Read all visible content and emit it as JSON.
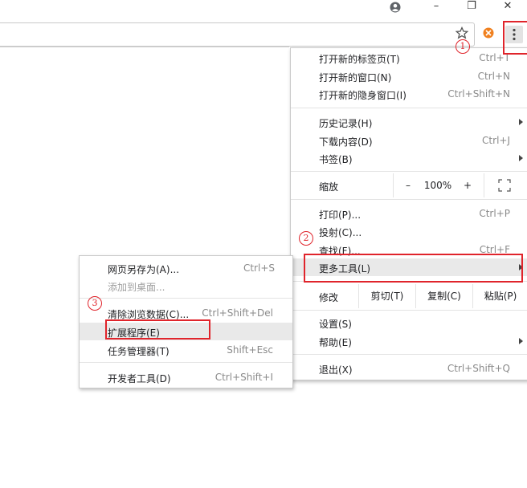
{
  "window": {
    "account_icon": "account-circle-icon",
    "minimize": "–",
    "restore": "❐",
    "close": "✕"
  },
  "toolbar": {
    "bookmark_icon": "star-icon",
    "extension_icon": "extension-orange-icon",
    "menu_icon": "three-dot-menu-icon"
  },
  "annotations": {
    "one": "1",
    "two": "2",
    "three": "3",
    "accent_color": "#e0242b"
  },
  "main_menu": {
    "new_tab": {
      "label": "打开新的标签页(T)",
      "shortcut": "Ctrl+T"
    },
    "new_window": {
      "label": "打开新的窗口(N)",
      "shortcut": "Ctrl+N"
    },
    "new_incognito": {
      "label": "打开新的隐身窗口(I)",
      "shortcut": "Ctrl+Shift+N"
    },
    "history": {
      "label": "历史记录(H)"
    },
    "downloads": {
      "label": "下载内容(D)",
      "shortcut": "Ctrl+J"
    },
    "bookmarks": {
      "label": "书签(B)"
    },
    "zoom": {
      "label": "缩放",
      "minus": "–",
      "value": "100%",
      "plus": "+",
      "fullscreen_icon": "fullscreen-icon"
    },
    "print": {
      "label": "打印(P)...",
      "shortcut": "Ctrl+P"
    },
    "cast": {
      "label": "投射(C)..."
    },
    "find": {
      "label": "查找(F)...",
      "shortcut": "Ctrl+F"
    },
    "more_tools": {
      "label": "更多工具(L)"
    },
    "edit": {
      "label": "修改",
      "cut": "剪切(T)",
      "copy": "复制(C)",
      "paste": "粘贴(P)"
    },
    "settings": {
      "label": "设置(S)"
    },
    "help": {
      "label": "帮助(E)"
    },
    "exit": {
      "label": "退出(X)",
      "shortcut": "Ctrl+Shift+Q"
    }
  },
  "sub_menu": {
    "save_as": {
      "label": "网页另存为(A)...",
      "shortcut": "Ctrl+S"
    },
    "add_to_desktop": {
      "label": "添加到桌面..."
    },
    "clear_data": {
      "label": "清除浏览数据(C)...",
      "shortcut": "Ctrl+Shift+Del"
    },
    "extensions": {
      "label": "扩展程序(E)"
    },
    "task_manager": {
      "label": "任务管理器(T)",
      "shortcut": "Shift+Esc"
    },
    "dev_tools": {
      "label": "开发者工具(D)",
      "shortcut": "Ctrl+Shift+I"
    }
  }
}
